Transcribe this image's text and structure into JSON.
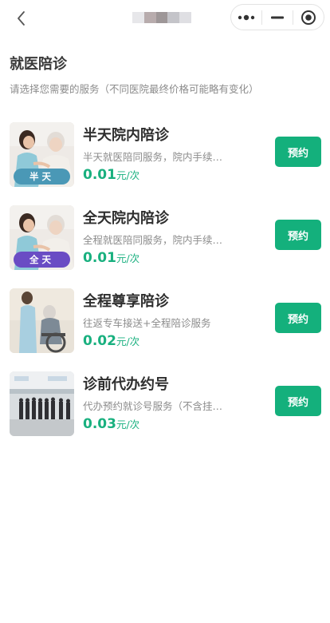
{
  "nav": {
    "title_colors": [
      "#e7e7ea",
      "#b8acad",
      "#9e9798",
      "#c4c4c9",
      "#dfdfe3"
    ]
  },
  "header": {
    "title": "就医陪诊",
    "subtitle": "请选择您需要的服务（不同医院最终价格可能略有变化）"
  },
  "colors": {
    "accent": "#14b07c",
    "price": "#19b07f",
    "badge_half": "#4a98b6",
    "badge_full": "#6a4cc4"
  },
  "services": [
    {
      "name": "半天院内陪诊",
      "desc": "半天就医陪同服务，院内手续全程陪同",
      "price": "0.01",
      "unit": "元/次",
      "badge": "半天",
      "image_icon": "nurse-elder-illustration",
      "button": "预约"
    },
    {
      "name": "全天院内陪诊",
      "desc": "全程就医陪同服务，院内手续全程陪同",
      "price": "0.01",
      "unit": "元/次",
      "badge": "全天",
      "image_icon": "nurse-elder-illustration",
      "button": "预约"
    },
    {
      "name": "全程尊享陪诊",
      "desc": "往返专车接送+全程陪诊服务",
      "price": "0.02",
      "unit": "元/次",
      "badge": "",
      "image_icon": "wheelchair-caregiver-photo",
      "button": "预约"
    },
    {
      "name": "诊前代办约号",
      "desc": "代办预约就诊号服务（不含挂号费用）",
      "price": "0.03",
      "unit": "元/次",
      "badge": "",
      "image_icon": "hospital-queue-photo",
      "button": "预约"
    }
  ]
}
